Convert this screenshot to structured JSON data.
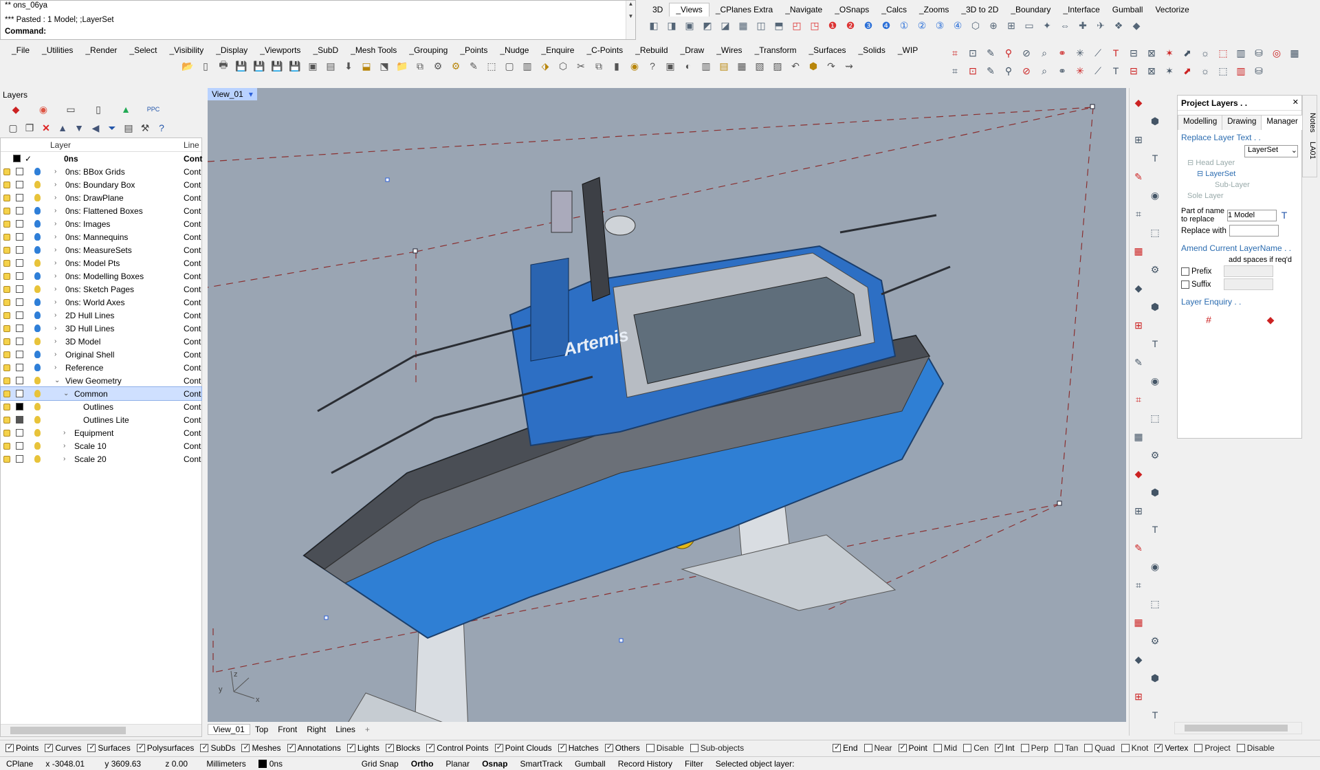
{
  "command": {
    "line1": "** ons_06ya",
    "line2": "*** Pasted : 1 Model; ;LayerSet",
    "prompt": "Command:"
  },
  "toolbar_tabs_top": [
    "3D",
    "_Views",
    "_CPlanes Extra",
    "_Navigate",
    "_OSnaps",
    "_Calcs",
    "_Zooms",
    "_3D to 2D",
    "_Boundary",
    "_Interface",
    "Gumball",
    "Vectorize"
  ],
  "toolbar_tabs_main": [
    "_File",
    "_Utilities",
    "_Render",
    "_Select",
    "_Visibility",
    "_Display",
    "_Viewports",
    "_SubD",
    "_Mesh Tools",
    "_Grouping",
    "_Points",
    "_Nudge",
    "_Enquire",
    "_C-Points",
    "_Rebuild",
    "_Draw",
    "_Wires",
    "_Transform",
    "_Surfaces",
    "_Solids",
    "_WIP"
  ],
  "layers": {
    "panel_title": "Layers",
    "col_layer": "Layer",
    "col_line": "Line",
    "root": "0ns",
    "root_line": "Cont",
    "rows": [
      {
        "name": "0ns: BBox Grids",
        "line": "Cont",
        "indent": 0,
        "expand": "›",
        "bulb": "#2f7fd8"
      },
      {
        "name": "0ns: Boundary Box",
        "line": "Cont",
        "indent": 0,
        "expand": "›",
        "bulb": "#e8c33a"
      },
      {
        "name": "0ns: DrawPlane",
        "line": "Cont",
        "indent": 0,
        "expand": "›",
        "bulb": "#e8c33a"
      },
      {
        "name": "0ns: Flattened Boxes",
        "line": "Cont",
        "indent": 0,
        "expand": "›",
        "bulb": "#2f7fd8"
      },
      {
        "name": "0ns: Images",
        "line": "Cont",
        "indent": 0,
        "expand": "›",
        "bulb": "#2f7fd8"
      },
      {
        "name": "0ns: Mannequins",
        "line": "Cont",
        "indent": 0,
        "expand": "›",
        "bulb": "#2f7fd8"
      },
      {
        "name": "0ns: MeasureSets",
        "line": "Cont",
        "indent": 0,
        "expand": "›",
        "bulb": "#2f7fd8"
      },
      {
        "name": "0ns: Model Pts",
        "line": "Cont",
        "indent": 0,
        "expand": "›",
        "bulb": "#e8c33a"
      },
      {
        "name": "0ns: Modelling Boxes",
        "line": "Cont",
        "indent": 0,
        "expand": "›",
        "bulb": "#2f7fd8"
      },
      {
        "name": "0ns: Sketch Pages",
        "line": "Cont",
        "indent": 0,
        "expand": "›",
        "bulb": "#e8c33a"
      },
      {
        "name": "0ns: World Axes",
        "line": "Cont",
        "indent": 0,
        "expand": "›",
        "bulb": "#2f7fd8"
      },
      {
        "name": "2D Hull Lines",
        "line": "Cont",
        "indent": 0,
        "expand": "›",
        "bulb": "#2f7fd8"
      },
      {
        "name": "3D Hull Lines",
        "line": "Cont",
        "indent": 0,
        "expand": "›",
        "bulb": "#2f7fd8"
      },
      {
        "name": "3D Model",
        "line": "Cont",
        "indent": 0,
        "expand": "›",
        "bulb": "#e8c33a"
      },
      {
        "name": "Original Shell",
        "line": "Cont",
        "indent": 0,
        "expand": "›",
        "bulb": "#2f7fd8"
      },
      {
        "name": "Reference",
        "line": "Cont",
        "indent": 0,
        "expand": "›",
        "bulb": "#2f7fd8"
      },
      {
        "name": "View Geometry",
        "line": "Cont",
        "indent": 0,
        "expand": "⌄",
        "bulb": "#e8c33a"
      },
      {
        "name": "Common",
        "line": "Cont",
        "indent": 1,
        "expand": "⌄",
        "bulb": "#e8c33a",
        "selected": true
      },
      {
        "name": "Outlines",
        "line": "Cont",
        "indent": 2,
        "expand": "",
        "bulb": "#e8c33a",
        "color": "black"
      },
      {
        "name": "Outlines Lite",
        "line": "Cont",
        "indent": 2,
        "expand": "",
        "bulb": "#e8c33a",
        "color": "dark"
      },
      {
        "name": "Equipment",
        "line": "Cont",
        "indent": 1,
        "expand": "›",
        "bulb": "#e8c33a"
      },
      {
        "name": "Scale 10",
        "line": "Cont",
        "indent": 1,
        "expand": "›",
        "bulb": "#e8c33a"
      },
      {
        "name": "Scale 20",
        "line": "Cont",
        "indent": 1,
        "expand": "›",
        "bulb": "#e8c33a"
      }
    ]
  },
  "viewport": {
    "title": "View_01",
    "boat_name": "Artemis",
    "tabs": [
      "View_01",
      "Top",
      "Front",
      "Right",
      "Lines"
    ],
    "tab_add": "+",
    "axis_x": "x",
    "axis_y": "y",
    "axis_z": "z"
  },
  "project_layers": {
    "title": "Project Layers . .",
    "tabs": [
      "Modelling",
      "Drawing",
      "Manager"
    ],
    "replace_text": "Replace Layer Text . .",
    "layerset_select": "LayerSet",
    "tree": [
      "Head Layer",
      "LayerSet",
      "Sub-Layer",
      "Sole Layer"
    ],
    "part_label_1": "Part of name",
    "part_label_2": "to replace",
    "part_value": "1 Model",
    "replace_with": "Replace with",
    "amend_title": "Amend Current LayerName . .",
    "add_spaces": "add spaces if req'd",
    "prefix": "Prefix",
    "suffix": "Suffix",
    "enquiry": "Layer Enquiry . .",
    "notes": "Notes",
    "la_tag": "LA01"
  },
  "filters": [
    {
      "label": "Points",
      "on": true
    },
    {
      "label": "Curves",
      "on": true
    },
    {
      "label": "Surfaces",
      "on": true
    },
    {
      "label": "Polysurfaces",
      "on": true
    },
    {
      "label": "SubDs",
      "on": true
    },
    {
      "label": "Meshes",
      "on": true
    },
    {
      "label": "Annotations",
      "on": true
    },
    {
      "label": "Lights",
      "on": true
    },
    {
      "label": "Blocks",
      "on": true
    },
    {
      "label": "Control Points",
      "on": true
    },
    {
      "label": "Point Clouds",
      "on": true
    },
    {
      "label": "Hatches",
      "on": true
    },
    {
      "label": "Others",
      "on": true
    },
    {
      "label": "Disable",
      "on": false
    },
    {
      "label": "Sub-objects",
      "on": false
    }
  ],
  "osnaps": [
    {
      "label": "End",
      "on": true
    },
    {
      "label": "Near",
      "on": false
    },
    {
      "label": "Point",
      "on": true
    },
    {
      "label": "Mid",
      "on": false
    },
    {
      "label": "Cen",
      "on": false
    },
    {
      "label": "Int",
      "on": true
    },
    {
      "label": "Perp",
      "on": false
    },
    {
      "label": "Tan",
      "on": false
    },
    {
      "label": "Quad",
      "on": false
    },
    {
      "label": "Knot",
      "on": false
    },
    {
      "label": "Vertex",
      "on": true
    },
    {
      "label": "Project",
      "on": false
    },
    {
      "label": "Disable",
      "on": false
    }
  ],
  "status": {
    "cplane": "CPlane",
    "x": "x -3048.01",
    "y": "y 3609.63",
    "z": "z 0.00",
    "units": "Millimeters",
    "layer": "0ns",
    "toggles": [
      "Grid Snap",
      "Ortho",
      "Planar",
      "Osnap",
      "SmartTrack",
      "Gumball",
      "Record History",
      "Filter"
    ],
    "message": "Selected object layer:"
  }
}
